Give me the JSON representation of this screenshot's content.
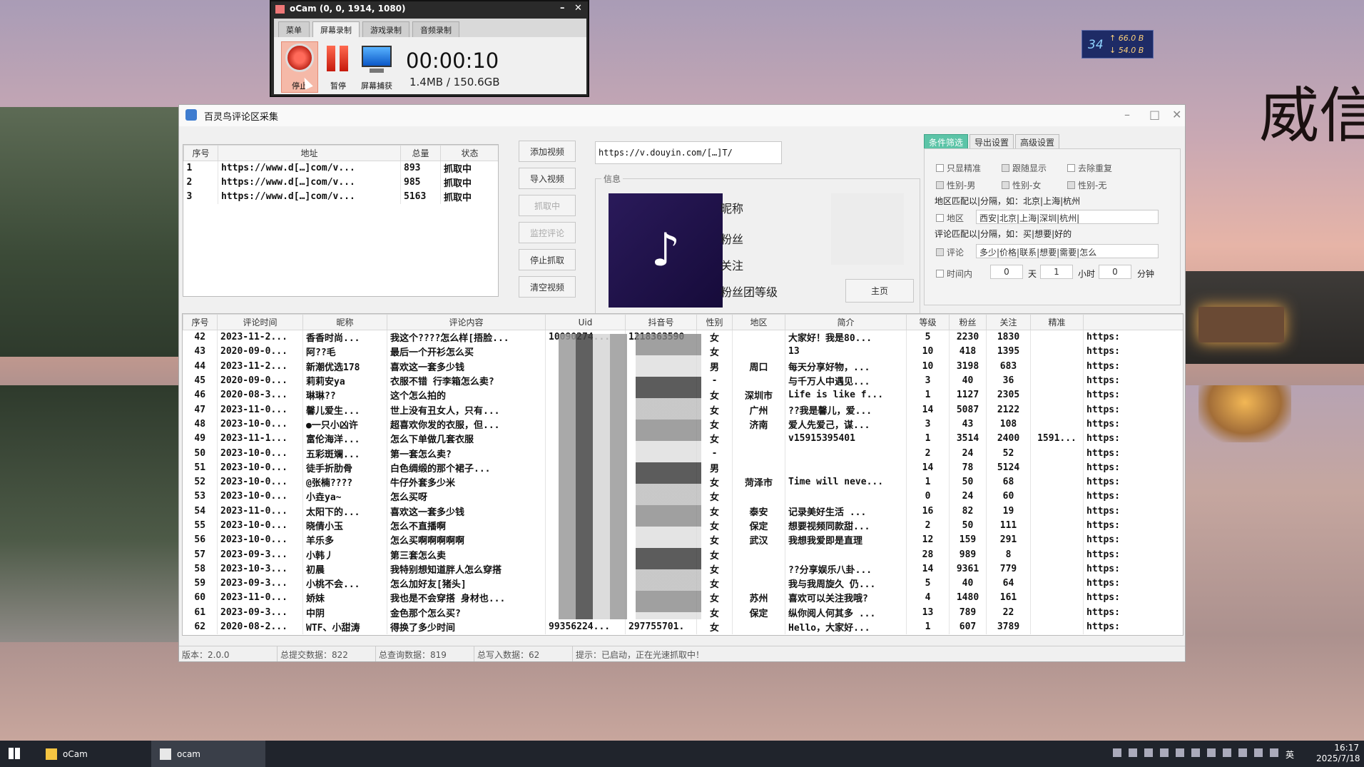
{
  "ocam": {
    "title": "oCam (0, 0, 1914, 1080)",
    "tabs": [
      "菜单",
      "屏幕录制",
      "游戏录制",
      "音频录制"
    ],
    "stop_label": "停止",
    "pause_label": "暂停",
    "capture_label": "屏幕捕获",
    "timer": "00:00:10",
    "size": "1.4MB / 150.6GB"
  },
  "netmeter": {
    "big": "34",
    "up": "↑ 66.0 B",
    "down": "↓ 54.0 B"
  },
  "watermark": "威信",
  "app": {
    "title": "百灵鸟评论区采集",
    "video_table": {
      "headers": [
        "序号",
        "地址",
        "总量",
        "状态"
      ],
      "rows": [
        [
          "1",
          "https://www.d[…]com/v...",
          "893",
          "抓取中"
        ],
        [
          "2",
          "https://www.d[…]com/v...",
          "985",
          "抓取中"
        ],
        [
          "3",
          "https://www.d[…]com/v...",
          "5163",
          "抓取中"
        ]
      ]
    },
    "buttons": {
      "add": "添加视频",
      "import": "导入视频",
      "fetching": "抓取中",
      "monitor": "监控评论",
      "stop": "停止抓取",
      "clear": "清空视频"
    },
    "url": "https://v.douyin.com/[…]T/",
    "info": {
      "legend": "信息",
      "nickname_label": "昵称",
      "fans_label": "粉丝",
      "follow_label": "关注",
      "fan_level_label": "粉丝团等级",
      "home_button": "主页"
    },
    "filter": {
      "tabs": [
        "条件筛选",
        "导出设置",
        "高级设置"
      ],
      "only_precise": "只显精准",
      "follow_show": "跟随显示",
      "dedupe": "去除重复",
      "gender_male": "性别-男",
      "gender_female": "性别-女",
      "gender_none": "性别-无",
      "region_hint": "地区匹配以|分隔，如：北京|上海|杭州",
      "region_label": "地区",
      "region_value": "西安|北京|上海|深圳|杭州|",
      "comment_hint": "评论匹配以|分隔，如：买|想要|好的",
      "comment_label": "评论",
      "comment_value": "多少|价格|联系|想要|需要|怎么",
      "time_label": "时间内",
      "days": "0",
      "days_unit": "天",
      "hours": "1",
      "hours_unit": "小时",
      "minutes": "0",
      "minutes_unit": "分钟"
    },
    "comments": {
      "headers": [
        "序号",
        "评论时间",
        "昵称",
        "评论内容",
        "Uid",
        "抖音号",
        "性别",
        "地区",
        "简介",
        "等级",
        "粉丝",
        "关注",
        "精准",
        ""
      ],
      "rows": [
        [
          "42",
          "2023-11-2...",
          "香香时尚...",
          "我这个????怎么样[捂脸...",
          "10090274...",
          "1218363590",
          "女",
          "",
          "大家好！我是80...",
          "5",
          "2230",
          "1830",
          "",
          "https:"
        ],
        [
          "43",
          "2020-09-0...",
          "阿??毛",
          "最后一个开衫怎么买",
          "",
          "",
          "女",
          "",
          "13",
          "10",
          "418",
          "1395",
          "",
          "https:"
        ],
        [
          "44",
          "2023-11-2...",
          "新潮优选178",
          "喜欢这一套多少钱",
          "",
          "",
          "男",
          "周口",
          "每天分享好物，...",
          "10",
          "3198",
          "683",
          "",
          "https:"
        ],
        [
          "45",
          "2020-09-0...",
          "莉莉安ya",
          "衣服不错 行李箱怎么卖?",
          "",
          "",
          "-",
          "",
          "与千万人中遇见...",
          "3",
          "40",
          "36",
          "",
          "https:"
        ],
        [
          "46",
          "2020-08-3...",
          "琳琳??",
          "这个怎么拍的",
          "",
          "",
          "女",
          "深圳市",
          "Life is like f...",
          "1",
          "1127",
          "2305",
          "",
          "https:"
        ],
        [
          "47",
          "2023-11-0...",
          "馨儿爱生...",
          "世上没有丑女人，只有...",
          "",
          "",
          "女",
          "广州",
          "??我是馨儿，爱...",
          "14",
          "5087",
          "2122",
          "",
          "https:"
        ],
        [
          "48",
          "2023-10-0...",
          "●一只小凶许",
          "超喜欢你发的衣服，但...",
          "",
          "",
          "女",
          "济南",
          "爱人先爱己，谋...",
          "3",
          "43",
          "108",
          "",
          "https:"
        ],
        [
          "49",
          "2023-11-1...",
          "富伦海洋...",
          "怎么下单做几套衣服",
          "",
          "",
          "女",
          "",
          "v15915395401",
          "1",
          "3514",
          "2400",
          "1591...",
          "https:"
        ],
        [
          "50",
          "2023-10-0...",
          "五彩斑斓...",
          "第一套怎么卖?",
          "",
          "",
          "-",
          "",
          "",
          "2",
          "24",
          "52",
          "",
          "https:"
        ],
        [
          "51",
          "2023-10-0...",
          "徒手折肋骨",
          "白色绸缎的那个裙子...",
          "",
          "",
          "男",
          "",
          "",
          "14",
          "78",
          "5124",
          "",
          "https:"
        ],
        [
          "52",
          "2023-10-0...",
          "@张楠????",
          "牛仔外套多少米",
          "",
          "",
          "女",
          "菏泽市",
          "Time will neve...",
          "1",
          "50",
          "68",
          "",
          "https:"
        ],
        [
          "53",
          "2023-10-0...",
          "小垚ya~",
          "怎么买呀",
          "",
          "",
          "女",
          "",
          "",
          "0",
          "24",
          "60",
          "",
          "https:"
        ],
        [
          "54",
          "2023-11-0...",
          "太阳下的...",
          "喜欢这一套多少钱",
          "",
          "",
          "女",
          "泰安",
          "记录美好生活  ...",
          "16",
          "82",
          "19",
          "",
          "https:"
        ],
        [
          "55",
          "2023-10-0...",
          "晓倩小玉",
          "怎么不直播啊",
          "",
          "",
          "女",
          "保定",
          "想要视频同款甜...",
          "2",
          "50",
          "111",
          "",
          "https:"
        ],
        [
          "56",
          "2023-10-0...",
          "羊乐多",
          "怎么买啊啊啊啊啊",
          "",
          "",
          "女",
          "武汉",
          "我想我爱即是直理",
          "12",
          "159",
          "291",
          "",
          "https:"
        ],
        [
          "57",
          "2023-09-3...",
          "小韩丿",
          "第三套怎么卖",
          "",
          "",
          "女",
          "",
          "",
          "28",
          "989",
          "8",
          "",
          "https:"
        ],
        [
          "58",
          "2023-10-3...",
          "初晨",
          "我特别想知道胖人怎么穿搭",
          "",
          "",
          "女",
          "",
          "??分享娱乐八卦...",
          "14",
          "9361",
          "779",
          "",
          "https:"
        ],
        [
          "59",
          "2023-09-3...",
          "小桃不会...",
          "怎么加好友[猪头]",
          "",
          "",
          "女",
          "",
          "我与我周旋久 仍...",
          "5",
          "40",
          "64",
          "",
          "https:"
        ],
        [
          "60",
          "2023-11-0...",
          "娇妹",
          "我也是不会穿搭 身材也...",
          "",
          "",
          "女",
          "苏州",
          "喜欢可以关注我哦?",
          "4",
          "1480",
          "161",
          "",
          "https:"
        ],
        [
          "61",
          "2023-09-3...",
          "中阴",
          "金色那个怎么买?",
          "",
          "",
          "女",
          "保定",
          "纵你阅人何其多 ...",
          "13",
          "789",
          "22",
          "",
          "https:"
        ],
        [
          "62",
          "2020-08-2...",
          "WTF、小甜涛",
          "得换了多少时间",
          "99356224...",
          "297755701.",
          "女",
          "",
          "Hello，大家好...",
          "1",
          "607",
          "3789",
          "",
          "https:"
        ]
      ]
    },
    "status": {
      "version": "版本：2.0.0",
      "submitted": "总提交数据：822",
      "queried": "总查询数据：819",
      "written": "总写入数据：62",
      "hint": "提示：已启动，正在光速抓取中！"
    }
  },
  "taskbar": {
    "app1": "oCam",
    "app2": "ocam",
    "ime": "英",
    "time": "16:17",
    "date": "2025/7/18"
  }
}
